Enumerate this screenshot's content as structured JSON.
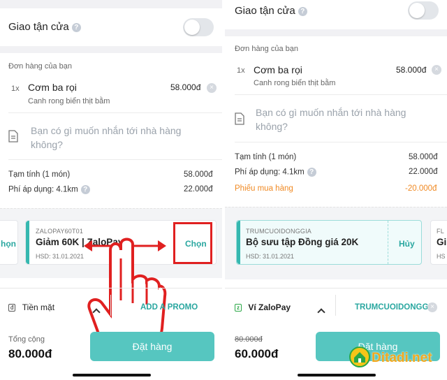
{
  "left": {
    "delivery": {
      "label": "Giao tận cửa"
    },
    "orders": {
      "header": "Đơn hàng của bạn",
      "item": {
        "qty": "1x",
        "name": "Cơm ba rọi",
        "price": "58.000đ",
        "desc": "Canh rong biển thịt bằm"
      }
    },
    "note_placeholder": "Bạn có gì muốn nhắn tới nhà hàng không?",
    "summary": [
      {
        "label": "Tạm tính  (1 món)",
        "value": "58.000đ"
      },
      {
        "label": "Phí áp dụng: 4.1km",
        "value": "22.000đ"
      }
    ],
    "vouchers": {
      "prev_action": "họn",
      "card": {
        "code": "ZALOPAY60T01",
        "title": "Giảm 60K | ZaloPay",
        "expiry": "HSD: 31.01.2021",
        "action": "Chọn"
      }
    },
    "payment": {
      "method": "Tiền mặt",
      "method_icon": "đ",
      "promo": "ADD A PROMO"
    },
    "total": {
      "label": "Tổng cộng",
      "value": "80.000đ"
    },
    "order_button": "Đặt hàng"
  },
  "right": {
    "delivery": {
      "label": "Giao tận cửa"
    },
    "orders": {
      "header": "Đơn hàng của bạn",
      "item": {
        "qty": "1x",
        "name": "Cơm ba rọi",
        "price": "58.000đ",
        "desc": "Canh rong biển thịt bằm"
      }
    },
    "note_placeholder": "Bạn có gì muốn nhắn tới nhà hàng không?",
    "summary": [
      {
        "label": "Tạm tính  (1 món)",
        "value": "58.000đ"
      },
      {
        "label": "Phí áp dụng: 4.1km",
        "value": "22.000đ"
      },
      {
        "label": "Phiếu mua hàng",
        "value": "-20.000đ"
      }
    ],
    "vouchers": {
      "card": {
        "code": "TRUMCUOIDONGGIA",
        "title": "Bộ sưu tập Đồng giá 20K",
        "expiry": "HSD: 31.01.2021",
        "action": "Hủy"
      },
      "next_code": "FL",
      "next_title": "Gi",
      "next_date": "HS"
    },
    "payment": {
      "method": "Ví ZaloPay",
      "method_icon": "zalo",
      "promo": "TRUMCUOIDONGGIA"
    },
    "total": {
      "old_value": "80.000đ",
      "value": "60.000đ"
    },
    "order_button": "Đặt hàng"
  },
  "watermark": "Ditadi.net",
  "colors": {
    "teal": "#2aa7a0",
    "button": "#56c6c0",
    "discount": "#f08a24",
    "highlight": "#e02020"
  }
}
